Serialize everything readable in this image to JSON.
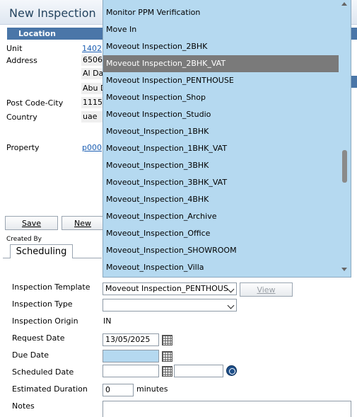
{
  "window": {
    "title": "New Inspection"
  },
  "location": {
    "header": "Location",
    "unit_label": "Unit",
    "unit_value": "1402",
    "address_label": "Address",
    "address_line1": "6506",
    "address_line2": "Al Da",
    "address_line3": "Abu D",
    "postcode_label": "Post Code-City",
    "postcode_value": "1115",
    "country_label": "Country",
    "country_value": "uae",
    "property_label": "Property",
    "property_value": "p000"
  },
  "buttons": {
    "save": "Save",
    "new": "New",
    "view": "View"
  },
  "created_by_label": "Created By",
  "tabs": {
    "scheduling": "Scheduling"
  },
  "dropdown": {
    "options": [
      "Monitor PPM Verification",
      "Move In",
      "Moveout Inspection_2BHK",
      "Moveout Inspection_2BHK_VAT",
      "Moveout Inspection_PENTHOUSE",
      "Moveout Inspection_Shop",
      "Moveout Inspection_Studio",
      "Moveout_Inspection_1BHK",
      "Moveout_Inspection_1BHK_VAT",
      "Moveout_Inspection_3BHK",
      "Moveout_Inspection_3BHK_VAT",
      "Moveout_Inspection_4BHK",
      "Moveout_Inspection_Archive",
      "Moveout_Inspection_Office",
      "Moveout_Inspection_SHOWROOM",
      "Moveout_Inspection_Villa"
    ],
    "highlighted": "Moveout Inspection_2BHK_VAT"
  },
  "form": {
    "template_label": "Inspection Template",
    "template_value": "Moveout Inspection_PENTHOUS",
    "type_label": "Inspection Type",
    "type_value": "",
    "origin_label": "Inspection Origin",
    "origin_value": "IN",
    "request_date_label": "Request Date",
    "request_date_value": "13/05/2025",
    "due_date_label": "Due Date",
    "due_date_value": "",
    "scheduled_date_label": "Scheduled Date",
    "scheduled_date_value": "",
    "scheduled_time_value": "",
    "duration_label": "Estimated Duration",
    "duration_value": "0",
    "duration_unit": "minutes",
    "notes_label": "Notes"
  },
  "colors": {
    "dropdown_bg": "#b5d9f0",
    "selected_bg": "#7a7a7a",
    "header_blue": "#4a76a8",
    "due_date_bg": "#b5d9f0"
  }
}
